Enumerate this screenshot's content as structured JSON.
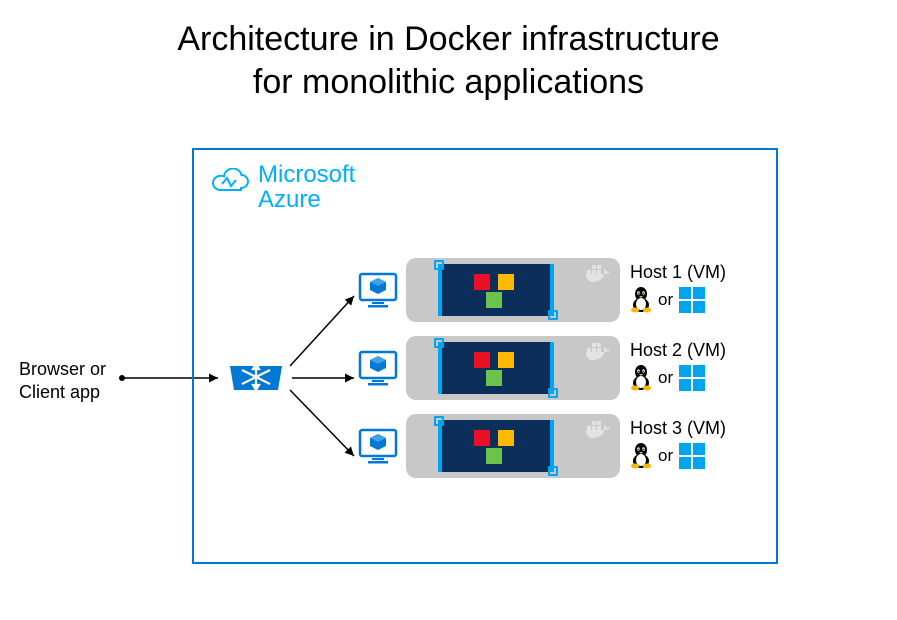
{
  "title_line1": "Architecture in Docker infrastructure",
  "title_line2": "for monolithic applications",
  "client": {
    "line1": "Browser or",
    "line2": "Client app"
  },
  "azure": {
    "name1": "Microsoft",
    "name2": "Azure"
  },
  "hosts": [
    {
      "label": "Host 1 (VM)",
      "or": "or"
    },
    {
      "label": "Host 2 (VM)",
      "or": "or"
    },
    {
      "label": "Host 3 (VM)",
      "or": "or"
    }
  ],
  "colors": {
    "azure_blue": "#0078d4",
    "azure_cyan": "#00b0ff",
    "container_bg": "#0b2e5a",
    "pill_gray": "#c8c8c8",
    "red": "#e81123",
    "yellow": "#ffb900",
    "green": "#6cc24a",
    "win_blue": "#00a4ef"
  },
  "diagram": {
    "source": "client",
    "via": "load-balancer",
    "targets": [
      "host1-vm",
      "host2-vm",
      "host3-vm"
    ],
    "host_os_options": [
      "linux",
      "windows"
    ],
    "container_apps_per_host": 3
  }
}
